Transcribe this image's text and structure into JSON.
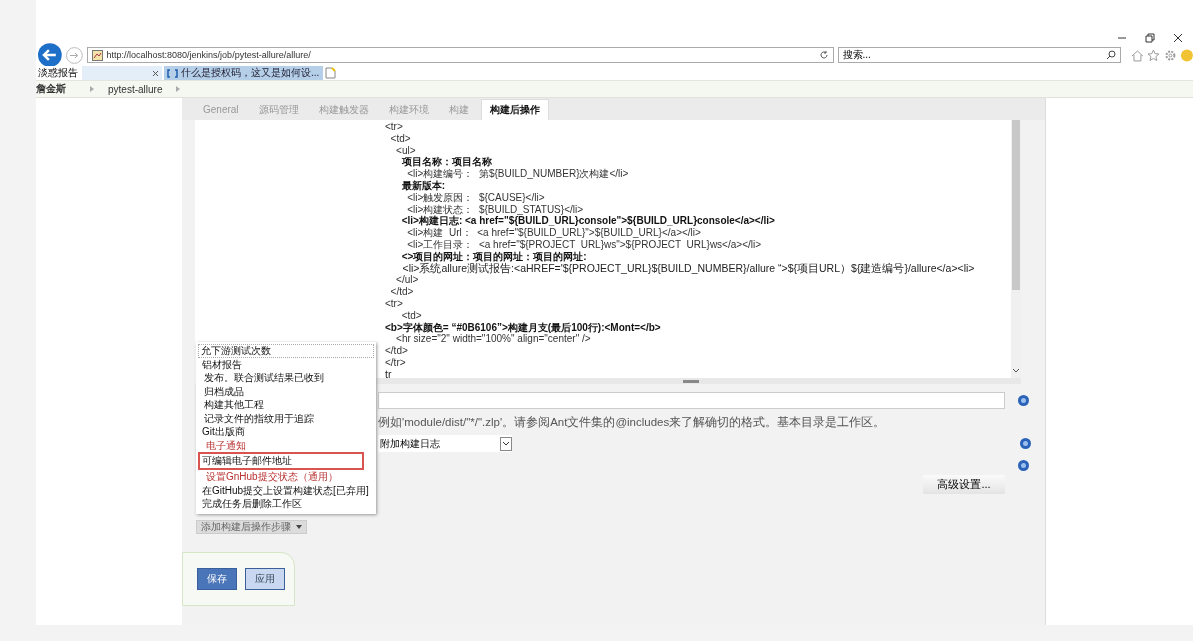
{
  "browser": {
    "address": "http://localhost:8080/jenkins/job/pytest-allure/allure/",
    "search_placeholder": "搜索...",
    "side_label": "淡惑报告",
    "tabs": [
      {
        "selected": false
      },
      {
        "label": "什么是授权码，这又是如何设...",
        "selected": true
      }
    ]
  },
  "breadcrumbs": [
    {
      "label": "詹金斯"
    },
    {
      "label": "pytest-allure"
    }
  ],
  "config_tabs": [
    {
      "label": "General",
      "selected": false
    },
    {
      "label": "源码管理",
      "selected": false
    },
    {
      "label": "构建触发器",
      "selected": false
    },
    {
      "label": "构建环境",
      "selected": false
    },
    {
      "label": "构建",
      "selected": false
    },
    {
      "label": "构建后操作",
      "selected": true
    }
  ],
  "code_lines": [
    {
      "text": "<tr>",
      "kind": "tag"
    },
    {
      "text": "  <td>",
      "kind": "tag"
    },
    {
      "text": "    <ul>",
      "kind": "tag"
    },
    {
      "text": "      项目名称：项目名称",
      "kind": "small"
    },
    {
      "text": "        <li>构建编号：  第${BUILD_NUMBER}次构建</li>",
      "kind": "tag"
    },
    {
      "text": "      最新版本:",
      "kind": "small"
    },
    {
      "text": "        <li>触发原因：  ${CAUSE}</li>",
      "kind": "tag"
    },
    {
      "text": "        <li>构建状态：  ${BUILD_STATUS}</li>",
      "kind": "tag"
    },
    {
      "text": "      <li>构建日志: <a href=\"${BUILD_URL}console\">${BUILD_URL}console</a></li>",
      "kind": "small"
    },
    {
      "text": "        <li>构建  Url：  <a href=\"${BUILD_URL}\">${BUILD_URL}</a></li>",
      "kind": "tag"
    },
    {
      "text": "        <li>工作目录：  <a href=\"${PROJECT  URL}ws\">${PROJECT  URL}ws</a></li>",
      "kind": "tag"
    },
    {
      "text": "      <>项目的网址：项目的网址：项目的网址:",
      "kind": "small"
    },
    {
      "text": "      <li>系统allure测试报告:<aHREF='${PROJECT_URL}${BUILD_NUMBER}/allure “>${项目URL）${建造编号}/allure</a><li>",
      "kind": "large"
    },
    {
      "text": "    </ul>",
      "kind": "tag"
    },
    {
      "text": "  </td>",
      "kind": "tag"
    },
    {
      "text": "<tr>",
      "kind": "tag"
    },
    {
      "text": "      <td>",
      "kind": "tag"
    },
    {
      "text": "<b>字体颜色= “#0B6106”>构建月支(最后100行):<Mont=</b>",
      "kind": "small"
    },
    {
      "text": "    <hr size=\"2\" width=\"100%\" align=\"center\" />",
      "kind": "tag"
    },
    {
      "text": "</td>",
      "kind": "tag"
    },
    {
      "text": "</tr>",
      "kind": "tag"
    },
    {
      "text": "tr",
      "kind": "large"
    }
  ],
  "hint": "例如'module/dist/\"*/\".zlp'。请参阅Ant文件集的@includes来了解确切的格式。基本目录是工作区。",
  "attach_select": "附加构建日志",
  "advanced_button": "高级设置...",
  "menu": [
    {
      "label": "允下游测试次数",
      "kind": "small",
      "selected": false
    },
    {
      "label": "铝材报告",
      "kind": "normal",
      "selected": false
    },
    {
      "label": "发布。联合测试结果已收到",
      "kind": "small",
      "selected": false
    },
    {
      "label": "归档成品",
      "kind": "small",
      "selected": false
    },
    {
      "label": "构建其他工程",
      "kind": "small",
      "selected": false
    },
    {
      "label": "记录文件的指纹用于追踪",
      "kind": "small",
      "selected": false
    },
    {
      "label": "Git出版商",
      "kind": "normal",
      "selected": false
    },
    {
      "label": "电子通知",
      "kind": "red",
      "selected": false
    },
    {
      "label": "可编辑电子邮件地址",
      "kind": "normal",
      "selected": true
    },
    {
      "label": "设置GnHub提交状态（通用）",
      "kind": "red",
      "selected": false
    },
    {
      "label": "在GitHub提交上设置构建状态[已弃用]",
      "kind": "normal",
      "selected": false
    },
    {
      "label": "完成任务后删除工作区",
      "kind": "normal",
      "selected": false
    }
  ],
  "add_step_button": "添加构建后操作步骤",
  "buttons": [
    {
      "label": "保存"
    },
    {
      "label": "应用"
    }
  ]
}
